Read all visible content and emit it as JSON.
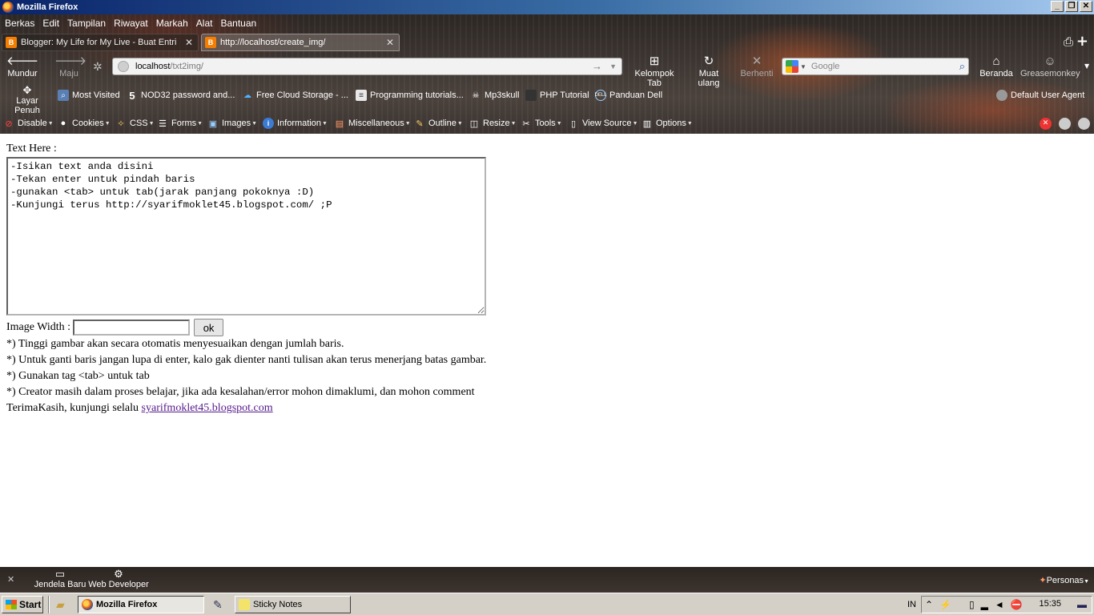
{
  "window": {
    "title": "Mozilla Firefox",
    "controls": [
      "_",
      "❐",
      "✕"
    ]
  },
  "menu": [
    "Berkas",
    "Edit",
    "Tampilan",
    "Riwayat",
    "Markah",
    "Alat",
    "Bantuan"
  ],
  "tabs": [
    {
      "title": "Blogger: My Life for My Live - Buat Entri",
      "icon": "blogger-icon",
      "active": false
    },
    {
      "title": "http://localhost/create_img/",
      "icon": "blogger-icon",
      "active": true
    }
  ],
  "nav": {
    "back": "Mundur",
    "forward": "Maju",
    "url_host": "localhost",
    "url_path": "/txt2img/",
    "group_tabs": "Kelompok Tab",
    "reload": "Muat ulang",
    "stop": "Berhenti",
    "search_placeholder": "Google",
    "home": "Beranda",
    "greasemonkey": "Greasemonkey"
  },
  "bookmarks": {
    "fullscreen": "Layar Penuh",
    "items": [
      "Most Visited",
      "NOD32 password and...",
      "Free Cloud Storage - ...",
      "Programming tutorials...",
      "Mp3skull",
      "PHP Tutorial",
      "Panduan Dell"
    ],
    "user_agent": "Default User Agent"
  },
  "devbar": [
    "Disable",
    "Cookies",
    "CSS",
    "Forms",
    "Images",
    "Information",
    "Miscellaneous",
    "Outline",
    "Resize",
    "Tools",
    "View Source",
    "Options"
  ],
  "page": {
    "text_label": "Text Here :",
    "textarea_value": "-Isikan text anda disini\n-Tekan enter untuk pindah baris\n-gunakan <tab> untuk tab(jarak panjang pokoknya :D)\n-Kunjungi terus http://syarifmoklet45.blogspot.com/ ;P",
    "width_label": "Image Width :",
    "width_value": "",
    "ok_label": "ok",
    "notes": [
      "*) Tinggi gambar akan secara otomatis menyesuaikan dengan jumlah baris.",
      "*) Untuk ganti baris jangan lupa di enter, kalo gak dienter nanti tulisan akan terus menerjang batas gambar.",
      "*) Gunakan tag <tab> untuk tab",
      "*) Creator masih dalam proses belajar, jika ada kesalahan/error mohon dimaklumi, dan mohon comment"
    ],
    "thanks_prefix": "TerimaKasih, kunjungi selalu ",
    "thanks_link": "syarifmoklet45.blogspot.com"
  },
  "addon_bar": {
    "new_window": "Jendela Baru",
    "web_developer": "Web Developer",
    "personas": "Personas"
  },
  "taskbar": {
    "start": "Start",
    "tasks": [
      "Mozilla Firefox",
      "Sticky Notes"
    ],
    "language": "IN",
    "clock": "15:35"
  }
}
